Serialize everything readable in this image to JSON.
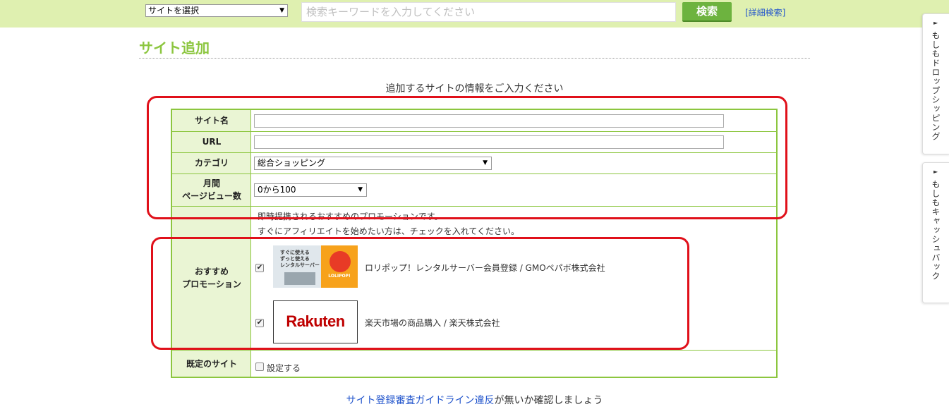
{
  "topbar": {
    "site_select": "サイトを選択",
    "search_placeholder": "検索キーワードを入力してください",
    "search_button": "検索",
    "advanced_search": "[詳細検索]"
  },
  "page": {
    "title": "サイト追加",
    "intro": "追加するサイトの情報をご入力ください"
  },
  "form": {
    "site_name_label": "サイト名",
    "url_label": "URL",
    "category_label": "カテゴリ",
    "category_value": "総合ショッピング",
    "pageview_label_1": "月間",
    "pageview_label_2": "ページビュー数",
    "pageview_value": "0から100",
    "promo_label_1": "おすすめ",
    "promo_label_2": "プロモーション",
    "promo_intro_1": "即時提携されるおすすめのプロモーションです。",
    "promo_intro_2": "すぐにアフィリエイトを始めたい方は、チェックを入れてください。",
    "promotions": [
      {
        "label": "ロリポップ！レンタルサーバー会員登録 / GMOペパボ株式会社",
        "checked": true
      },
      {
        "label": "楽天市場の商品購入 / 楽天株式会社",
        "checked": true
      }
    ],
    "default_site_label": "既定のサイト",
    "default_site_option": "設定する",
    "default_site_checked": false
  },
  "banners": {
    "lolipop_line1": "すぐに使える",
    "lolipop_line2": "ずっと使える",
    "lolipop_line3": "レンタルサーバー",
    "lolipop_brand": "LOLIPOP!",
    "rakuten_brand": "Rakuten"
  },
  "guide": {
    "link_text": "サイト登録審査ガイドライン違反",
    "suffix": "が無いか確認しましょう"
  },
  "side_tabs": [
    {
      "label": "もしもドロップシッピング"
    },
    {
      "label": "もしもキャッシュバック"
    }
  ],
  "colors": {
    "topbar_bg": "#dff0b0",
    "accent_green": "#8cc63f",
    "button_green": "#6db33f",
    "label_bg": "#eaf5d4",
    "annotation_red": "#e0101a",
    "link_blue": "#2255cc"
  }
}
